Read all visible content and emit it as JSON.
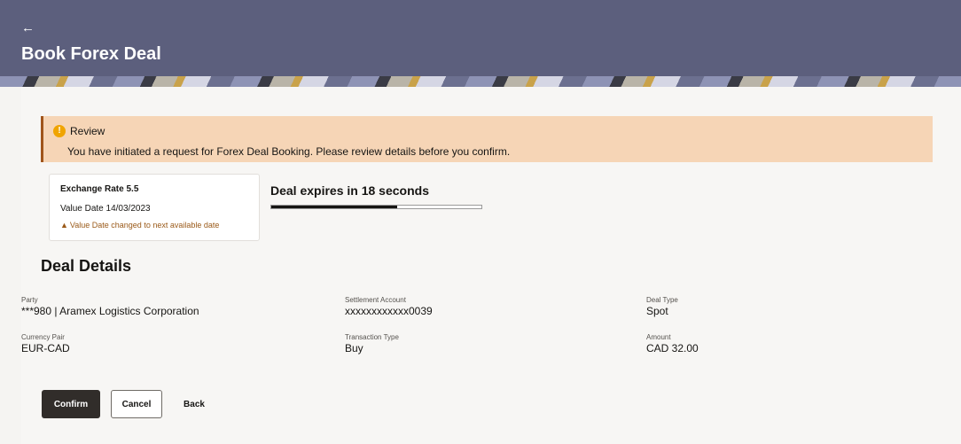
{
  "header": {
    "back_icon": "←",
    "title": "Book Forex Deal"
  },
  "alert": {
    "icon": "!",
    "title": "Review",
    "message": "You have initiated a request for Forex Deal Booking. Please review details before you confirm."
  },
  "rate_card": {
    "exchange_rate": "Exchange Rate 5.5",
    "value_date": "Value Date 14/03/2023",
    "warning": "Value Date changed to next available date"
  },
  "timer": {
    "text": "Deal expires in 18 seconds",
    "progress_fraction": 0.6
  },
  "details": {
    "title": "Deal Details",
    "fields": [
      {
        "label": "Party",
        "value": "***980 | Aramex Logistics Corporation"
      },
      {
        "label": "Settlement Account",
        "value": "xxxxxxxxxxxx0039"
      },
      {
        "label": "Deal Type",
        "value": "Spot"
      },
      {
        "label": "Currency Pair",
        "value": "EUR-CAD"
      },
      {
        "label": "Transaction Type",
        "value": "Buy"
      },
      {
        "label": "Amount",
        "value": "CAD 32.00"
      }
    ]
  },
  "actions": {
    "confirm": "Confirm",
    "cancel": "Cancel",
    "back": "Back"
  },
  "colors": {
    "header_bg": "#5c5f7d",
    "alert_bg": "#f6d5b6",
    "alert_border": "#a0541a",
    "warning_text": "#9a5a19",
    "primary_button": "#312d2a"
  }
}
